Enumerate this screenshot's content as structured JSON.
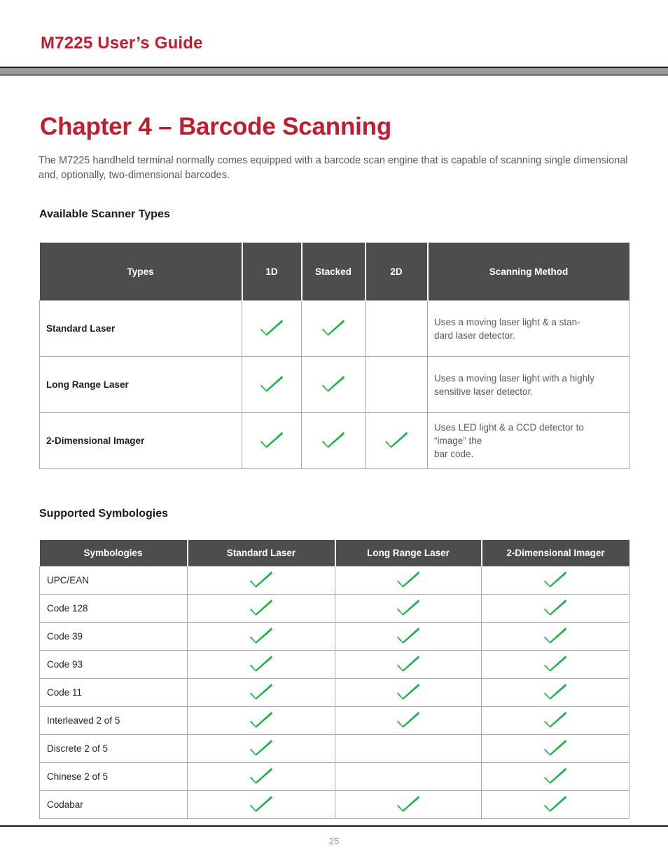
{
  "header": {
    "title": "M7225 User’s Guide"
  },
  "chapter": {
    "title": "Chapter 4 – Barcode Scanning",
    "intro": "The M7225 handheld terminal normally comes equipped with a barcode scan engine that is capable of scanning single dimensional and, optionally, two-dimensional barcodes."
  },
  "sections": {
    "available_scanner_types": "Available Scanner Types",
    "supported_symbologies": "Supported Symbologies"
  },
  "colors": {
    "brand_red": "#be1e2d",
    "header_gray": "#4d4d4d",
    "check_green": "#22b14c",
    "body_gray": "#58595b",
    "border_gray": "#a7a9ac"
  },
  "icons": {
    "check": "check-icon"
  },
  "scanner_types_table": {
    "columns": [
      "Types",
      "1D",
      "Stacked",
      "2D",
      "Scanning Method"
    ],
    "rows": [
      {
        "type": "Standard Laser",
        "one_d": true,
        "stacked": true,
        "two_d": false,
        "method_lines": [
          "Uses a moving laser light & a stan-",
          "dard laser detector."
        ]
      },
      {
        "type": "Long Range Laser",
        "one_d": true,
        "stacked": true,
        "two_d": false,
        "method_lines": [
          "Uses a moving laser light with a highly",
          "sensitive laser detector."
        ]
      },
      {
        "type": "2-Dimensional Imager",
        "one_d": true,
        "stacked": true,
        "two_d": true,
        "method_lines": [
          "Uses LED light & a CCD detector to",
          "“image” the",
          "bar code."
        ]
      }
    ]
  },
  "symbologies_table": {
    "columns": [
      "Symbologies",
      "Standard Laser",
      "Long Range Laser",
      "2-Dimensional Imager"
    ],
    "rows": [
      {
        "symbology": "UPC/EAN",
        "standard_laser": true,
        "long_range_laser": true,
        "two_dimensional_imager": true
      },
      {
        "symbology": "Code 128",
        "standard_laser": true,
        "long_range_laser": true,
        "two_dimensional_imager": true
      },
      {
        "symbology": "Code 39",
        "standard_laser": true,
        "long_range_laser": true,
        "two_dimensional_imager": true
      },
      {
        "symbology": "Code 93",
        "standard_laser": true,
        "long_range_laser": true,
        "two_dimensional_imager": true
      },
      {
        "symbology": "Code 11",
        "standard_laser": true,
        "long_range_laser": true,
        "two_dimensional_imager": true
      },
      {
        "symbology": "Interleaved 2 of 5",
        "standard_laser": true,
        "long_range_laser": true,
        "two_dimensional_imager": true
      },
      {
        "symbology": "Discrete 2 of 5",
        "standard_laser": true,
        "long_range_laser": false,
        "two_dimensional_imager": true
      },
      {
        "symbology": "Chinese 2 of 5",
        "standard_laser": true,
        "long_range_laser": false,
        "two_dimensional_imager": true
      },
      {
        "symbology": "Codabar",
        "standard_laser": true,
        "long_range_laser": true,
        "two_dimensional_imager": true
      }
    ]
  },
  "footer": {
    "page_number": "25"
  }
}
